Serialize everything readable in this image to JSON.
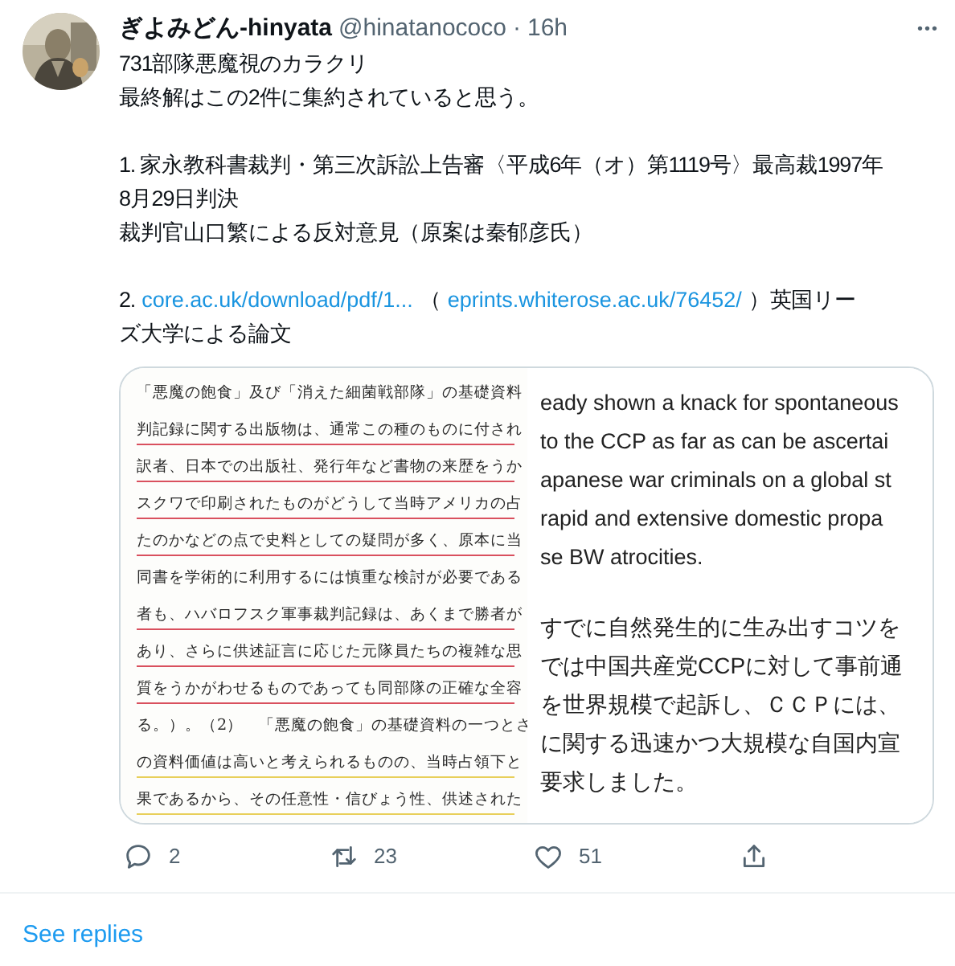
{
  "tweet": {
    "author_name": "ぎよみどん-hinyata",
    "handle": "@hinatanococo",
    "separator": "·",
    "time": "16h",
    "more": "•••",
    "body": [
      [
        [
          {
            "kind": "text",
            "text": "731部隊悪魔視のカラクリ"
          }
        ],
        [
          {
            "kind": "text",
            "text": "最終解はこの2件に集約されていると思う。"
          }
        ]
      ],
      [
        [
          {
            "kind": "text",
            "text": "1. 家永教科書裁判・第三次訴訟上告審〈平成6年（オ）第1119号〉最高裁1997年"
          }
        ],
        [
          {
            "kind": "text",
            "text": "8月29日判決"
          }
        ],
        [
          {
            "kind": "text",
            "text": "裁判官山口繁による反対意見（原案は秦郁彦氏）"
          }
        ]
      ],
      [
        [
          {
            "kind": "text",
            "text": "2."
          },
          {
            "kind": "link",
            "text": "core.ac.uk/download/pdf/1..."
          },
          {
            "kind": "text",
            "text": "（"
          },
          {
            "kind": "link",
            "text": "eprints.whiterose.ac.uk/76452/"
          },
          {
            "kind": "text",
            "text": "）英国リー"
          }
        ],
        [
          {
            "kind": "text",
            "text": "ズ大学による論文"
          }
        ]
      ]
    ],
    "scan_lines": [
      {
        "text": "「悪魔の飽食」及び「消えた細菌戦部隊」の基礎資料"
      },
      {
        "text": "判記録に関する出版物は、通常この種のものに付され",
        "color": "#d9505e"
      },
      {
        "text": "訳者、日本での出版社、発行年など書物の来歴をうか",
        "color": "#d9505e"
      },
      {
        "text": "スクワで印刷されたものがどうして当時アメリカの占",
        "color": "#d9505e"
      },
      {
        "text": "たのかなどの点で史料としての疑問が多く、原本に当",
        "color": "#d9505e"
      },
      {
        "text": "同書を学術的に利用するには慎重な検討が必要である"
      },
      {
        "text": "者も、ハバロフスク軍事裁判記録は、あくまで勝者が",
        "color": "#d9505e"
      },
      {
        "text": "あり、さらに供述証言に応じた元隊員たちの複雑な思",
        "color": "#d9505e"
      },
      {
        "text": "質をうかがわせるものであっても同部隊の正確な全容",
        "color": "#d9505e"
      },
      {
        "text": "る。）。（2）　「悪魔の飽食」の基礎資料の一つとさ"
      },
      {
        "text": "の資料価値は高いと考えられるものの、当時占領下と",
        "color": "#e8cf5a"
      },
      {
        "text": "果であるから、その任意性・信びょう性、供述された",
        "color": "#e8cf5a"
      }
    ],
    "english_lines": [
      "eady shown a knack for spontaneous",
      "to the CCP as far as can be ascertai",
      "apanese war criminals on a global st",
      "rapid and extensive domestic propa",
      "se BW atrocities."
    ],
    "japanese_lines": [
      "すでに自然発生的に生み出すコツを",
      "では中国共産党CCPに対して事前通",
      "を世界規模で起訴し、ＣＣＰには、",
      "に関する迅速かつ大規模な自国内宣",
      "要求しました。"
    ],
    "actions": [
      {
        "kind": "reply",
        "count": "2"
      },
      {
        "kind": "retweet",
        "count": "23"
      },
      {
        "kind": "like",
        "count": "51"
      },
      {
        "kind": "share"
      }
    ]
  },
  "see_replies": "See replies"
}
